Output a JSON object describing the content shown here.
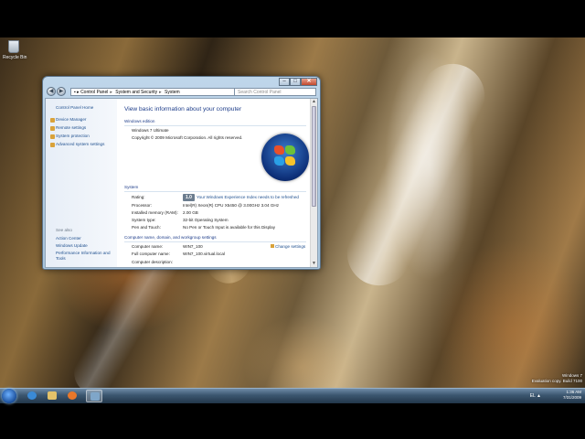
{
  "desktop": {
    "recycle_bin_label": "Recycle Bin",
    "watermark": [
      "Windows 7",
      "Evaluation copy. Build 7100"
    ]
  },
  "window": {
    "address": [
      "Control Panel",
      "System and Security",
      "System"
    ],
    "search_placeholder": "Search Control Panel",
    "left_pane": {
      "home": "Control Panel Home",
      "links": [
        "Device Manager",
        "Remote settings",
        "System protection",
        "Advanced system settings"
      ],
      "see_also_heading": "See also",
      "see_also": [
        "Action Center",
        "Windows Update",
        "Performance Information and Tools"
      ]
    },
    "main": {
      "title": "View basic information about your computer",
      "edition_heading": "Windows edition",
      "edition": "Windows 7 Ultimate",
      "copyright": "Copyright © 2009 Microsoft Corporation.  All rights reserved.",
      "system_heading": "System",
      "rating_label": "Rating:",
      "rating_value": "1.0",
      "rating_link": "Your Windows Experience Index needs to be refreshed",
      "processor_label": "Processor:",
      "processor_value": "Intel(R) Xeon(R) CPU          X5450  @ 3.00GHz   3.04 GHz",
      "memory_label": "Installed memory (RAM):",
      "memory_value": "2.00 GB",
      "systype_label": "System type:",
      "systype_value": "32-bit Operating System",
      "pen_label": "Pen and Touch:",
      "pen_value": "No Pen or Touch Input is available for this Display",
      "network_heading": "Computer name, domain, and workgroup settings",
      "computer_name_label": "Computer name:",
      "computer_name_value": "WIN7_100",
      "full_name_label": "Full computer name:",
      "full_name_value": "WIN7_100.virtual.local",
      "description_label": "Computer description:",
      "change_settings": "Change settings"
    }
  },
  "taskbar": {
    "tray_icons": "EL  ▲",
    "time": "1:36 AM",
    "date": "7/31/2009"
  },
  "colors": {
    "link": "#1e4f8e",
    "heading": "#1e3d8a",
    "taskbar": "#3b566f"
  }
}
